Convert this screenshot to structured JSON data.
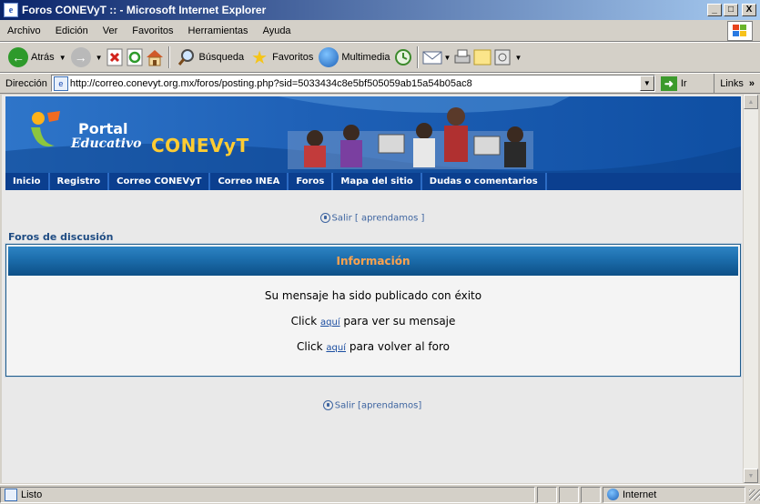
{
  "window": {
    "title": "Foros CONEVyT :: - Microsoft Internet Explorer",
    "minimize": "_",
    "maximize": "□",
    "close": "X"
  },
  "menu": [
    "Archivo",
    "Edición",
    "Ver",
    "Favoritos",
    "Herramientas",
    "Ayuda"
  ],
  "toolbar": {
    "back": "Atrás",
    "search": "Búsqueda",
    "favorites": "Favoritos",
    "media": "Multimedia"
  },
  "address": {
    "label": "Dirección",
    "url": "http://correo.conevyt.org.mx/foros/posting.php?sid=5033434c8e5bf505059ab15a54b05ac8",
    "go": "Ir",
    "links": "Links"
  },
  "banner": {
    "portal": "Portal",
    "educativo": "Educativo",
    "conevyt": "CONEVyT"
  },
  "nav": [
    "Inicio",
    "Registro",
    "Correo CONEVyT",
    "Correo INEA",
    "Foros",
    "Mapa del sitio",
    "Dudas o comentarios"
  ],
  "logout_top": "Salir [ aprendamos ]",
  "logout_bottom": "Salir [aprendamos]",
  "forum_link": "Foros de discusión",
  "info": {
    "heading": "Información",
    "message": "Su mensaje ha sido publicado con éxito",
    "line2_pre": "Click",
    "line2_link": "aquí",
    "line2_post": "para ver su mensaje",
    "line3_pre": "Click",
    "line3_link": "aquí",
    "line3_post": "para volver al foro"
  },
  "status": {
    "text": "Listo",
    "zone": "Internet"
  },
  "colors": {
    "banner_blue": "#1f61b7",
    "nav_blue": "#0b3f8f",
    "heading_orange": "#ffa34d",
    "link_blue": "#1a4da0"
  }
}
